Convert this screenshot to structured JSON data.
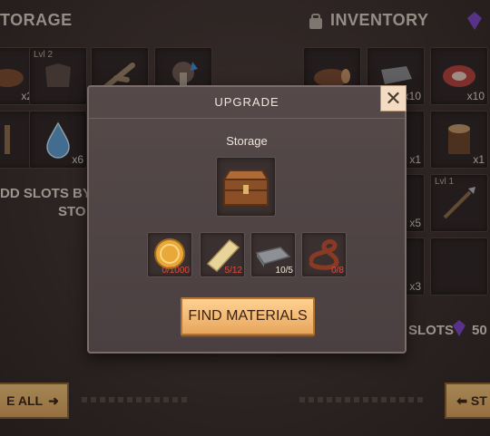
{
  "storage_panel": {
    "title": "TORAGE",
    "slots": [
      {
        "count": "x2"
      },
      {
        "level": "Lvl 2"
      },
      {
        "count": ""
      },
      {
        "count": ""
      },
      {
        "count": ""
      },
      {
        "count": "x6"
      }
    ],
    "add_slots_line1": "DD SLOTS BY U",
    "add_slots_line2": "STO",
    "move_all_button": "E ALL"
  },
  "inventory_panel": {
    "title": "INVENTORY",
    "slots": [
      {
        "count": ""
      },
      {
        "count": "x10"
      },
      {
        "count": "x10"
      },
      {
        "count": "x1"
      },
      {
        "count": "x1"
      },
      {
        "count": "x5"
      },
      {
        "level": "Lvl 1"
      },
      {
        "count": "x3"
      }
    ],
    "slots_label": "SLOTS",
    "slots_cost": "50",
    "store_button": "ST"
  },
  "modal": {
    "title": "UPGRADE",
    "subtitle": "Storage",
    "target_icon": "wooden-chest-icon",
    "materials": [
      {
        "icon": "gold-coin-icon",
        "required": "0/1000",
        "status": "short"
      },
      {
        "icon": "plank-icon",
        "required": "5/12",
        "status": "short"
      },
      {
        "icon": "iron-ingot-icon",
        "required": "10/5",
        "status": "ok"
      },
      {
        "icon": "leather-rope-icon",
        "required": "0/8",
        "status": "short"
      }
    ],
    "find_button": "FIND MATERIALS",
    "close_icon": "close-icon"
  },
  "colors": {
    "accent_gold": "#e7a65c",
    "shortage_red": "#e04a3b",
    "close_bg": "#f3dcc2",
    "gem_purple": "#7d45c9"
  }
}
